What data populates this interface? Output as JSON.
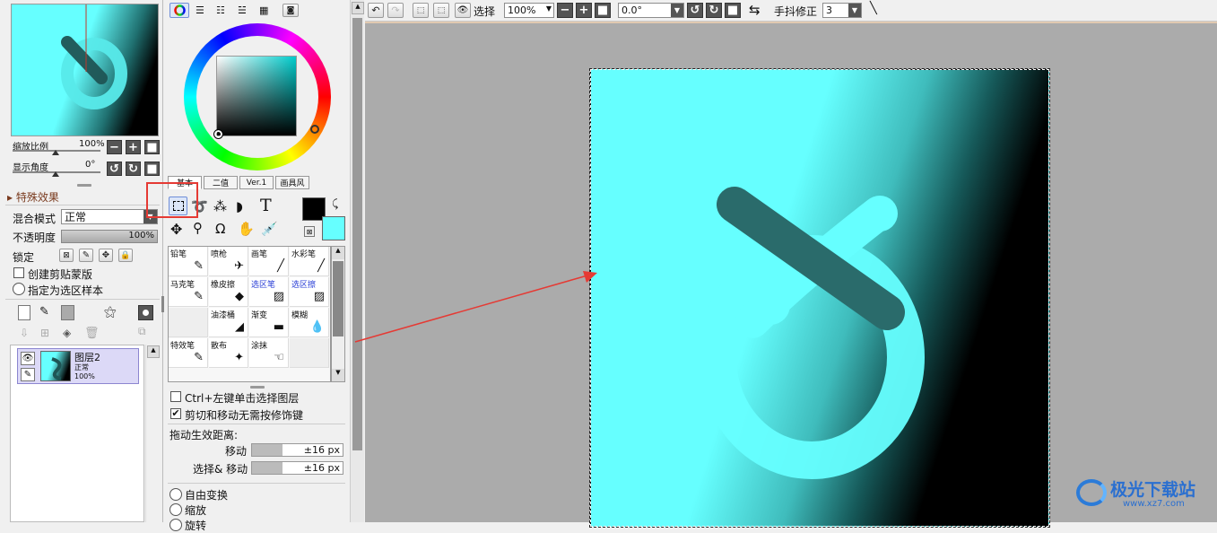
{
  "navigator": {
    "zoom_label": "缩放比例",
    "zoom_value": "100%",
    "angle_label": "显示角度",
    "angle_value": "0°"
  },
  "layer_panel": {
    "effects_label": "特殊效果",
    "blend_mode_label": "混合模式",
    "blend_mode_value": "正常",
    "opacity_label": "不透明度",
    "opacity_value": "100%",
    "lock_label": "锁定",
    "clipping_label": "创建剪贴蒙版",
    "selection_source_label": "指定为选区样本",
    "layer": {
      "name": "图层2",
      "mode": "正常",
      "opacity": "100%"
    }
  },
  "color_panel": {
    "tabs": [
      "基本",
      "二值",
      "Ver.1",
      "画具风"
    ],
    "foreground_color": "#000000",
    "background_color": "#66ffff"
  },
  "brushes": [
    {
      "label": "铅笔",
      "icon": "pencil-icon",
      "glyph": "✎",
      "highlight": false
    },
    {
      "label": "喷枪",
      "icon": "airbrush-icon",
      "glyph": "✈",
      "highlight": false
    },
    {
      "label": "画笔",
      "icon": "brush-icon",
      "glyph": "╱",
      "highlight": false
    },
    {
      "label": "水彩笔",
      "icon": "watercolor-icon",
      "glyph": "╱",
      "highlight": false
    },
    {
      "label": "马克笔",
      "icon": "marker-icon",
      "glyph": "✎",
      "highlight": false
    },
    {
      "label": "橡皮擦",
      "icon": "eraser-icon",
      "glyph": "◆",
      "highlight": false
    },
    {
      "label": "选区笔",
      "icon": "selection-pen-icon",
      "glyph": "▨",
      "highlight": true
    },
    {
      "label": "选区擦",
      "icon": "selection-eraser-icon",
      "glyph": "▨",
      "highlight": true
    },
    {
      "label": "",
      "icon": "",
      "glyph": "",
      "highlight": false
    },
    {
      "label": "油漆桶",
      "icon": "bucket-icon",
      "glyph": "◢",
      "highlight": false
    },
    {
      "label": "渐变",
      "icon": "gradient-icon",
      "glyph": "▬",
      "highlight": false
    },
    {
      "label": "模糊",
      "icon": "blur-icon",
      "glyph": "💧",
      "highlight": false
    },
    {
      "label": "特效笔",
      "icon": "fx-pen-icon",
      "glyph": "✎",
      "highlight": false
    },
    {
      "label": "散布",
      "icon": "scatter-icon",
      "glyph": "✦",
      "highlight": false
    },
    {
      "label": "涂抹",
      "icon": "smudge-icon",
      "glyph": "☜",
      "highlight": false
    },
    {
      "label": "",
      "icon": "",
      "glyph": "",
      "highlight": false
    }
  ],
  "tool_options": {
    "ctrl_select_label": "Ctrl+左键单击选择图层",
    "cut_move_label": "剪切和移动无需按修饰键",
    "drag_distance_label": "拖动生效距离:",
    "move_label": "移动",
    "move_value": "±16 px",
    "select_move_label": "选择& 移动",
    "select_move_value": "±16 px",
    "free_transform_label": "自由变换",
    "scale_label": "缩放",
    "rotate_label": "旋转"
  },
  "toolbar": {
    "select_label": "选择",
    "zoom_value": "100%",
    "angle_value": "0.0°",
    "stabilizer_label": "手抖修正",
    "stabilizer_value": "3"
  },
  "watermark": {
    "text": "极光下载站",
    "url_text": "www.xz7.com"
  }
}
